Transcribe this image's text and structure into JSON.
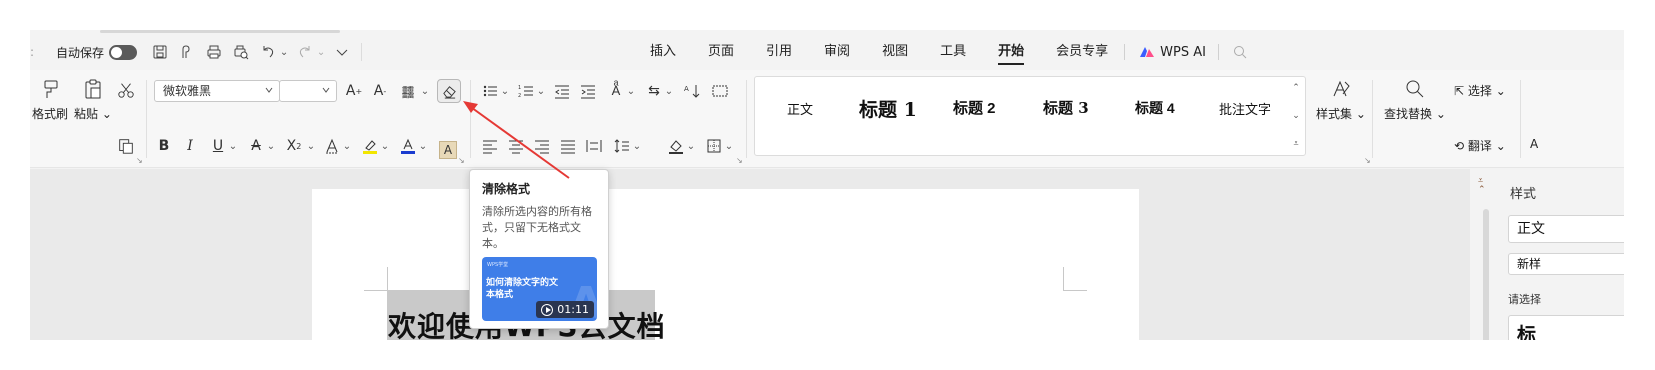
{
  "quick_access": {
    "autosave_label": "自动保存",
    "autosave_on": false
  },
  "tabs": [
    "插入",
    "页面",
    "引用",
    "审阅",
    "视图",
    "工具",
    "开始",
    "会员专享"
  ],
  "active_tab": "开始",
  "wps_ai_label": "WPS AI",
  "ribbon": {
    "format_painter_label": "格式刷",
    "paste_label": "粘贴",
    "font_name": "微软雅黑",
    "font_size": "",
    "styles": [
      "正文",
      "标题 1",
      "标题 2",
      "标题 3",
      "标题 4",
      "批注文字"
    ],
    "style_set_label": "样式集",
    "find_replace_label": "查找替换",
    "select_label": "选择",
    "translate_label": "翻译",
    "cut_off_label": "A"
  },
  "tooltip": {
    "title": "清除格式",
    "description": "清除所选内容的所有格式，只留下无格式文本。",
    "video_brand": "WPS学堂",
    "video_title": "如何清除文字的文本格式",
    "video_duration": "01:11"
  },
  "document": {
    "heading": "欢迎使用WPS云文档"
  },
  "right_panel": {
    "title": "样式",
    "style_box": "正文",
    "new_style_button": "新样",
    "hint": "请选择",
    "preview": "标"
  },
  "colors": {
    "annotation_arrow": "#e53935",
    "highlight": "#f2e600",
    "font_color": "#1a3ccf",
    "video_bg": "#3f7ee8"
  }
}
